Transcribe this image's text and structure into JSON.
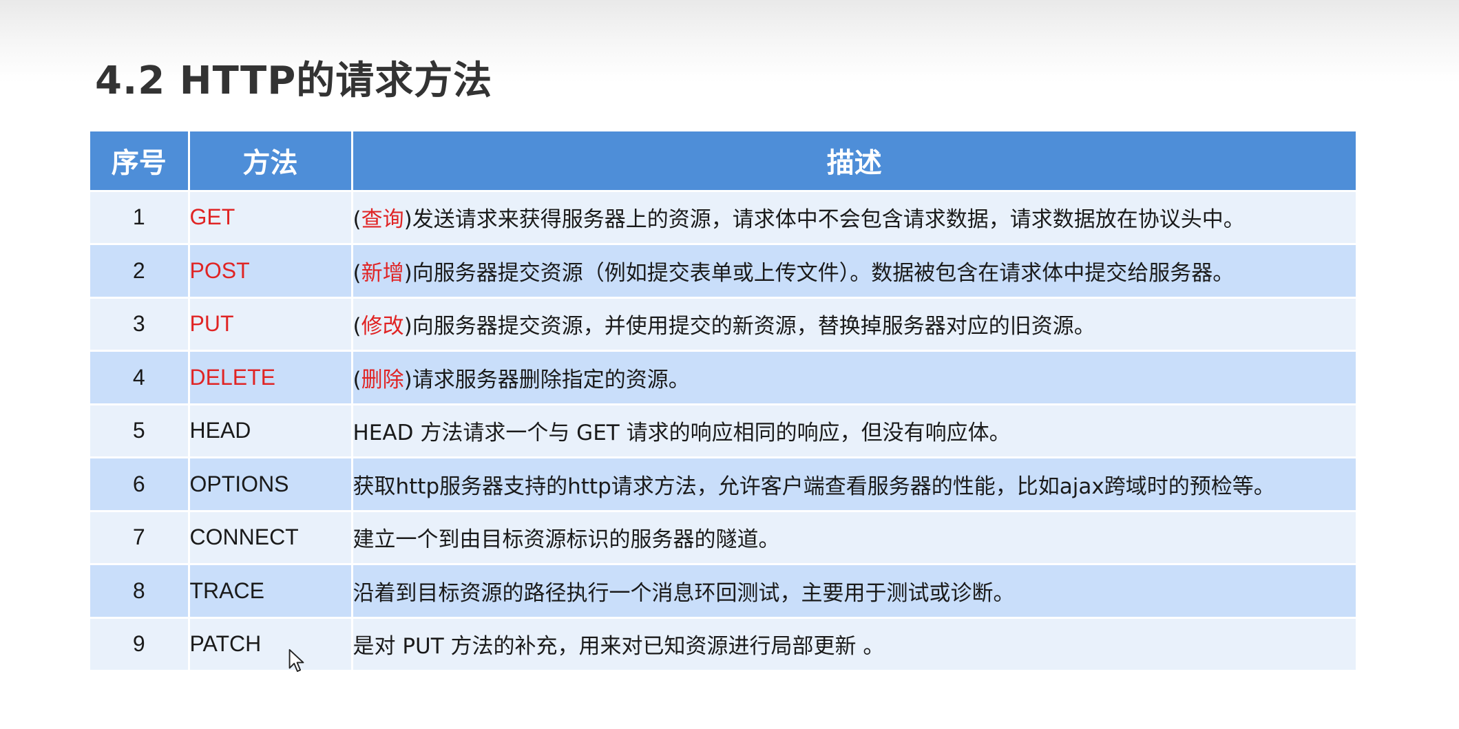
{
  "slide": {
    "title": "4.2 HTTP的请求方法"
  },
  "table": {
    "headers": [
      "序号",
      "方法",
      "描述"
    ],
    "rows": [
      {
        "num": "1",
        "method": "GET",
        "tag": "查询",
        "rest": ")发送请求来获得服务器上的资源，请求体中不会包含请求数据，请求数据放在协议头中。"
      },
      {
        "num": "2",
        "method": "POST",
        "tag": "新增",
        "rest": ")向服务器提交资源（例如提交表单或上传文件）。数据被包含在请求体中提交给服务器。"
      },
      {
        "num": "3",
        "method": "PUT",
        "tag": "修改",
        "rest": ")向服务器提交资源，并使用提交的新资源，替换掉服务器对应的旧资源。"
      },
      {
        "num": "4",
        "method": "DELETE",
        "tag": "删除",
        "rest": ")请求服务器删除指定的资源。"
      },
      {
        "num": "5",
        "method": "HEAD",
        "desc": "HEAD 方法请求一个与 GET 请求的响应相同的响应，但没有响应体。"
      },
      {
        "num": "6",
        "method": "OPTIONS",
        "desc": "获取http服务器支持的http请求方法，允许客户端查看服务器的性能，比如ajax跨域时的预检等。"
      },
      {
        "num": "7",
        "method": "CONNECT",
        "desc": "建立一个到由目标资源标识的服务器的隧道。"
      },
      {
        "num": "8",
        "method": "TRACE",
        "desc": "沿着到目标资源的路径执行一个消息环回测试，主要用于测试或诊断。"
      },
      {
        "num": "9",
        "method": "PATCH",
        "desc": "是对 PUT 方法的补充，用来对已知资源进行局部更新 。"
      }
    ]
  },
  "colors": {
    "header_bg": "#4e8ed8",
    "row_light": "#e9f1fb",
    "row_dark": "#c9defa",
    "highlight_red": "#e02424"
  },
  "icons": {
    "cursor": "mouse-pointer-icon"
  }
}
